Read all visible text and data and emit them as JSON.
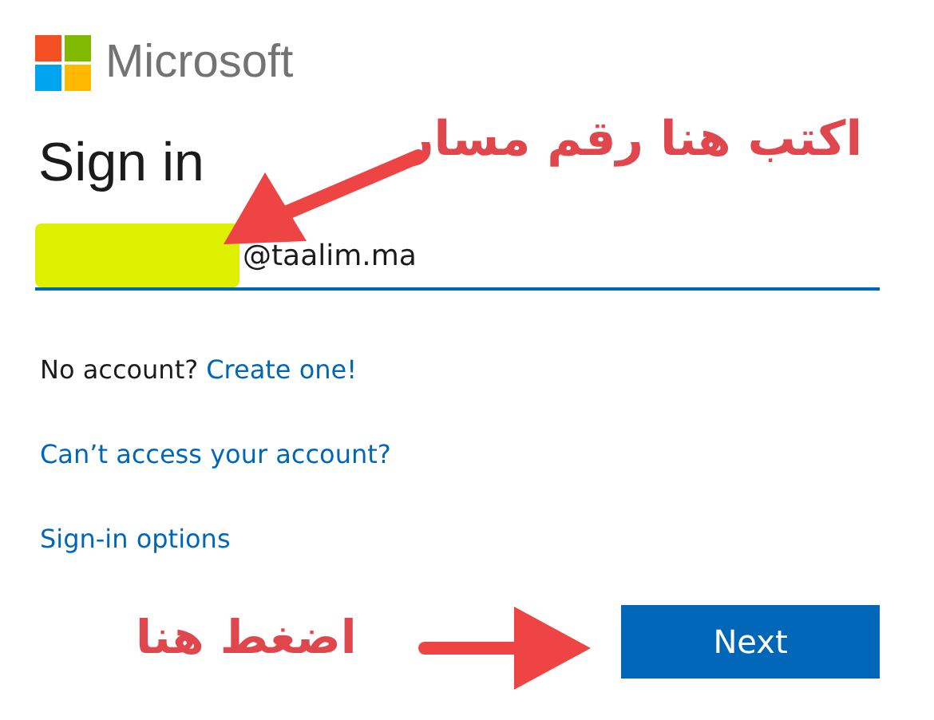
{
  "brand": {
    "name": "Microsoft"
  },
  "heading": "Sign in",
  "email_field": {
    "value": "@taalim.ma"
  },
  "no_account": {
    "text": "No account?",
    "link": "Create one!"
  },
  "links": [
    "Can’t access your account?",
    "Sign-in options"
  ],
  "next_button": {
    "label": "Next"
  },
  "annotations": [
    {
      "text": "اكتب هنا رقم مسار"
    },
    {
      "text": "اضغط هنا"
    }
  ]
}
